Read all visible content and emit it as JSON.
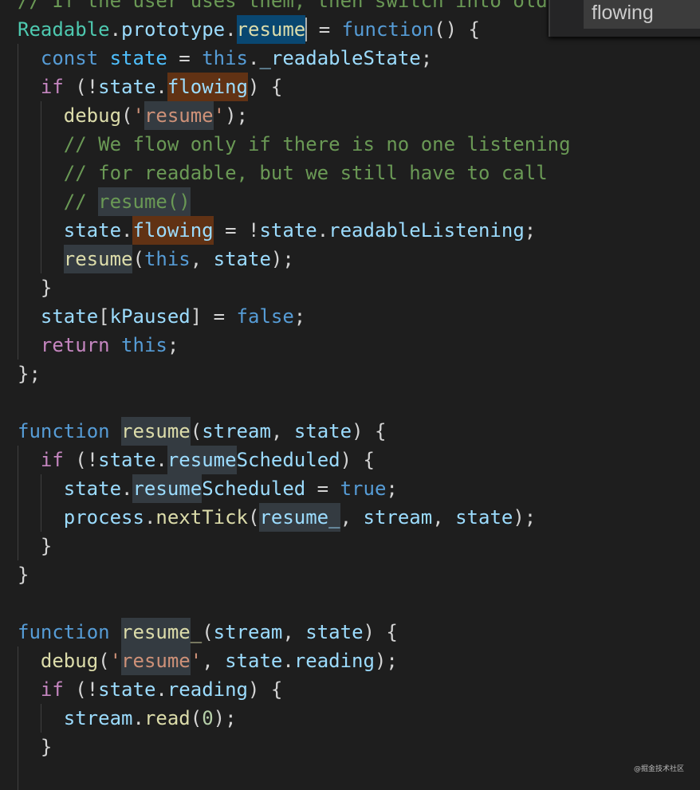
{
  "colors": {
    "background": "#1e1e1e",
    "selection": "#094771",
    "word_highlight": "#613214",
    "occurrence": "#343b41"
  },
  "find_widget": {
    "value": "flowing"
  },
  "watermark": "@掘金技术社区",
  "code": [
    {
      "indent": 0,
      "tokens": [
        [
          "// If the user uses them, then switch into old",
          "cm"
        ]
      ]
    },
    {
      "indent": 0,
      "tokens": [
        [
          "Readable",
          "cl"
        ],
        [
          ".",
          ""
        ],
        [
          "prototype",
          "vr"
        ],
        [
          ".",
          ""
        ],
        [
          "resume",
          "fn sel"
        ],
        [
          "|cursor",
          ""
        ],
        [
          " = ",
          ""
        ],
        [
          "function",
          "kw"
        ],
        [
          "() {",
          ""
        ]
      ]
    },
    {
      "indent": 1,
      "tokens": [
        [
          "const",
          "kw"
        ],
        [
          " ",
          ""
        ],
        [
          "state",
          "cs"
        ],
        [
          " = ",
          ""
        ],
        [
          "this",
          "kw"
        ],
        [
          ".",
          ""
        ],
        [
          "_readableState",
          "vr"
        ],
        [
          ";",
          ""
        ]
      ]
    },
    {
      "indent": 1,
      "tokens": [
        [
          "if",
          "ct"
        ],
        [
          " (!",
          ""
        ],
        [
          "state",
          "vr"
        ],
        [
          ".",
          ""
        ],
        [
          "flowing",
          "vr wr"
        ],
        [
          ") {",
          ""
        ]
      ]
    },
    {
      "indent": 2,
      "tokens": [
        [
          "debug",
          "fn"
        ],
        [
          "(",
          ""
        ],
        [
          "'",
          "st"
        ],
        [
          "resume",
          "st hl"
        ],
        [
          "'",
          "st"
        ],
        [
          ");",
          ""
        ]
      ]
    },
    {
      "indent": 2,
      "tokens": [
        [
          "// We flow only if there is no one listening",
          "cm"
        ]
      ]
    },
    {
      "indent": 2,
      "tokens": [
        [
          "// for readable, but we still have to call",
          "cm"
        ]
      ]
    },
    {
      "indent": 2,
      "tokens": [
        [
          "// ",
          "cm"
        ],
        [
          "resume()",
          "cm hl"
        ]
      ]
    },
    {
      "indent": 2,
      "tokens": [
        [
          "state",
          "vr"
        ],
        [
          ".",
          ""
        ],
        [
          "flowing",
          "vr wr"
        ],
        [
          " = !",
          ""
        ],
        [
          "state",
          "vr"
        ],
        [
          ".",
          ""
        ],
        [
          "readableListening",
          "vr"
        ],
        [
          ";",
          ""
        ]
      ]
    },
    {
      "indent": 2,
      "tokens": [
        [
          "resume",
          "fn hl"
        ],
        [
          "(",
          ""
        ],
        [
          "this",
          "kw"
        ],
        [
          ", ",
          ""
        ],
        [
          "state",
          "vr"
        ],
        [
          ");",
          ""
        ]
      ]
    },
    {
      "indent": 1,
      "tokens": [
        [
          "}",
          ""
        ]
      ]
    },
    {
      "indent": 1,
      "tokens": [
        [
          "state",
          "vr"
        ],
        [
          "[",
          ""
        ],
        [
          "kPaused",
          "vr"
        ],
        [
          "] = ",
          ""
        ],
        [
          "false",
          "kw"
        ],
        [
          ";",
          ""
        ]
      ]
    },
    {
      "indent": 1,
      "tokens": [
        [
          "return",
          "ct"
        ],
        [
          " ",
          ""
        ],
        [
          "this",
          "kw"
        ],
        [
          ";",
          ""
        ]
      ]
    },
    {
      "indent": 0,
      "tokens": [
        [
          "};",
          ""
        ]
      ]
    },
    {
      "indent": 0,
      "tokens": []
    },
    {
      "indent": 0,
      "tokens": [
        [
          "function",
          "kw"
        ],
        [
          " ",
          ""
        ],
        [
          "resume",
          "fn hl"
        ],
        [
          "(",
          ""
        ],
        [
          "stream",
          "vr"
        ],
        [
          ", ",
          ""
        ],
        [
          "state",
          "vr"
        ],
        [
          ") {",
          ""
        ]
      ]
    },
    {
      "indent": 1,
      "tokens": [
        [
          "if",
          "ct"
        ],
        [
          " (!",
          ""
        ],
        [
          "state",
          "vr"
        ],
        [
          ".",
          ""
        ],
        [
          "resume",
          "vr hl"
        ],
        [
          "Scheduled",
          "vr"
        ],
        [
          ") {",
          ""
        ]
      ]
    },
    {
      "indent": 2,
      "tokens": [
        [
          "state",
          "vr"
        ],
        [
          ".",
          ""
        ],
        [
          "resume",
          "vr hl"
        ],
        [
          "Scheduled",
          "vr"
        ],
        [
          " = ",
          ""
        ],
        [
          "true",
          "kw"
        ],
        [
          ";",
          ""
        ]
      ]
    },
    {
      "indent": 2,
      "tokens": [
        [
          "process",
          "vr"
        ],
        [
          ".",
          ""
        ],
        [
          "nextTick",
          "fn"
        ],
        [
          "(",
          ""
        ],
        [
          "resume_",
          "vr hl"
        ],
        [
          ", ",
          ""
        ],
        [
          "stream",
          "vr"
        ],
        [
          ", ",
          ""
        ],
        [
          "state",
          "vr"
        ],
        [
          ");",
          ""
        ]
      ]
    },
    {
      "indent": 1,
      "tokens": [
        [
          "}",
          ""
        ]
      ]
    },
    {
      "indent": 0,
      "tokens": [
        [
          "}",
          ""
        ]
      ]
    },
    {
      "indent": 0,
      "tokens": []
    },
    {
      "indent": 0,
      "tokens": [
        [
          "function",
          "kw"
        ],
        [
          " ",
          ""
        ],
        [
          "resume",
          "fn hl"
        ],
        [
          "_",
          "fn"
        ],
        [
          "(",
          ""
        ],
        [
          "stream",
          "vr"
        ],
        [
          ", ",
          ""
        ],
        [
          "state",
          "vr"
        ],
        [
          ") {",
          ""
        ]
      ]
    },
    {
      "indent": 1,
      "tokens": [
        [
          "debug",
          "fn"
        ],
        [
          "(",
          ""
        ],
        [
          "'",
          "st"
        ],
        [
          "resume",
          "st hl"
        ],
        [
          "'",
          "st"
        ],
        [
          ", ",
          ""
        ],
        [
          "state",
          "vr"
        ],
        [
          ".",
          ""
        ],
        [
          "reading",
          "vr"
        ],
        [
          ");",
          ""
        ]
      ]
    },
    {
      "indent": 1,
      "tokens": [
        [
          "if",
          "ct"
        ],
        [
          " (!",
          ""
        ],
        [
          "state",
          "vr"
        ],
        [
          ".",
          ""
        ],
        [
          "reading",
          "vr"
        ],
        [
          ") {",
          ""
        ]
      ]
    },
    {
      "indent": 2,
      "tokens": [
        [
          "stream",
          "vr"
        ],
        [
          ".",
          ""
        ],
        [
          "read",
          "fn"
        ],
        [
          "(",
          ""
        ],
        [
          "0",
          "nu"
        ],
        [
          ");",
          ""
        ]
      ]
    },
    {
      "indent": 1,
      "tokens": [
        [
          "}",
          ""
        ]
      ]
    },
    {
      "indent": 1,
      "tokens": []
    }
  ]
}
